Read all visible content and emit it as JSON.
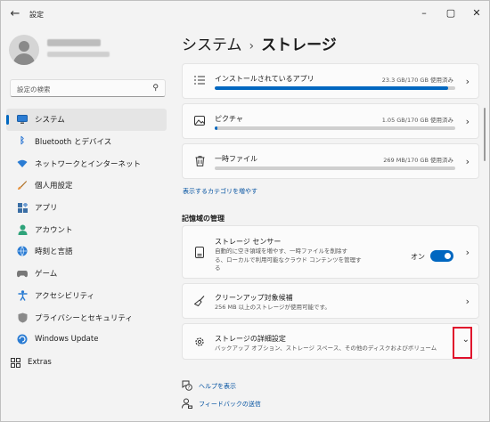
{
  "app": {
    "title": "設定"
  },
  "window_controls": {
    "minimize": "–",
    "maximize": "▢",
    "close": "✕"
  },
  "search": {
    "placeholder": "設定の検索"
  },
  "sidebar": {
    "items": [
      {
        "label": "システム",
        "icon": "system-icon",
        "active": true
      },
      {
        "label": "Bluetooth とデバイス",
        "icon": "bluetooth-icon"
      },
      {
        "label": "ネットワークとインターネット",
        "icon": "wifi-icon"
      },
      {
        "label": "個人用設定",
        "icon": "brush-icon"
      },
      {
        "label": "アプリ",
        "icon": "apps-icon"
      },
      {
        "label": "アカウント",
        "icon": "account-icon"
      },
      {
        "label": "時刻と言語",
        "icon": "globe-clock-icon"
      },
      {
        "label": "ゲーム",
        "icon": "gamepad-icon"
      },
      {
        "label": "アクセシビリティ",
        "icon": "accessibility-icon"
      },
      {
        "label": "プライバシーとセキュリティ",
        "icon": "shield-icon"
      },
      {
        "label": "Windows Update",
        "icon": "update-icon"
      },
      {
        "label": "Extras",
        "icon": "extras-icon"
      }
    ]
  },
  "breadcrumb": {
    "parent": "システム",
    "separator": "›",
    "current": "ストレージ"
  },
  "categories": [
    {
      "title": "インストールされているアプリ",
      "usage": "23.3 GB/170 GB 使用済み",
      "fraction": 0.97
    },
    {
      "title": "ピクチャ",
      "usage": "1.05 GB/170 GB 使用済み",
      "fraction": 0.01
    },
    {
      "title": "一時ファイル",
      "usage": "269 MB/170 GB 使用済み",
      "fraction": 0.0
    }
  ],
  "show_more_link": "表示するカテゴリを増やす",
  "management": {
    "heading": "記憶域の管理",
    "storage_sense": {
      "title": "ストレージ センサー",
      "desc_line1": "自動的に空き領域を増やす、一時ファイルを削除す",
      "desc_line2": "る、ローカルで利用可能なクラウド コンテンツを管理す",
      "desc_line3": "る",
      "toggle_label": "オン",
      "toggle_on": true
    },
    "cleanup": {
      "title": "クリーンアップ対象候補",
      "desc": "256 MB 以上のストレージが使用可能です。"
    },
    "advanced": {
      "title": "ストレージの詳細設定",
      "desc": "バックアップ オプション、ストレージ スペース、その他のディスクおよびボリューム"
    }
  },
  "footer": {
    "help": "ヘルプを表示",
    "feedback": "フィードバックの送信"
  },
  "colors": {
    "accent": "#0067c0",
    "highlight": "#e0102c"
  }
}
